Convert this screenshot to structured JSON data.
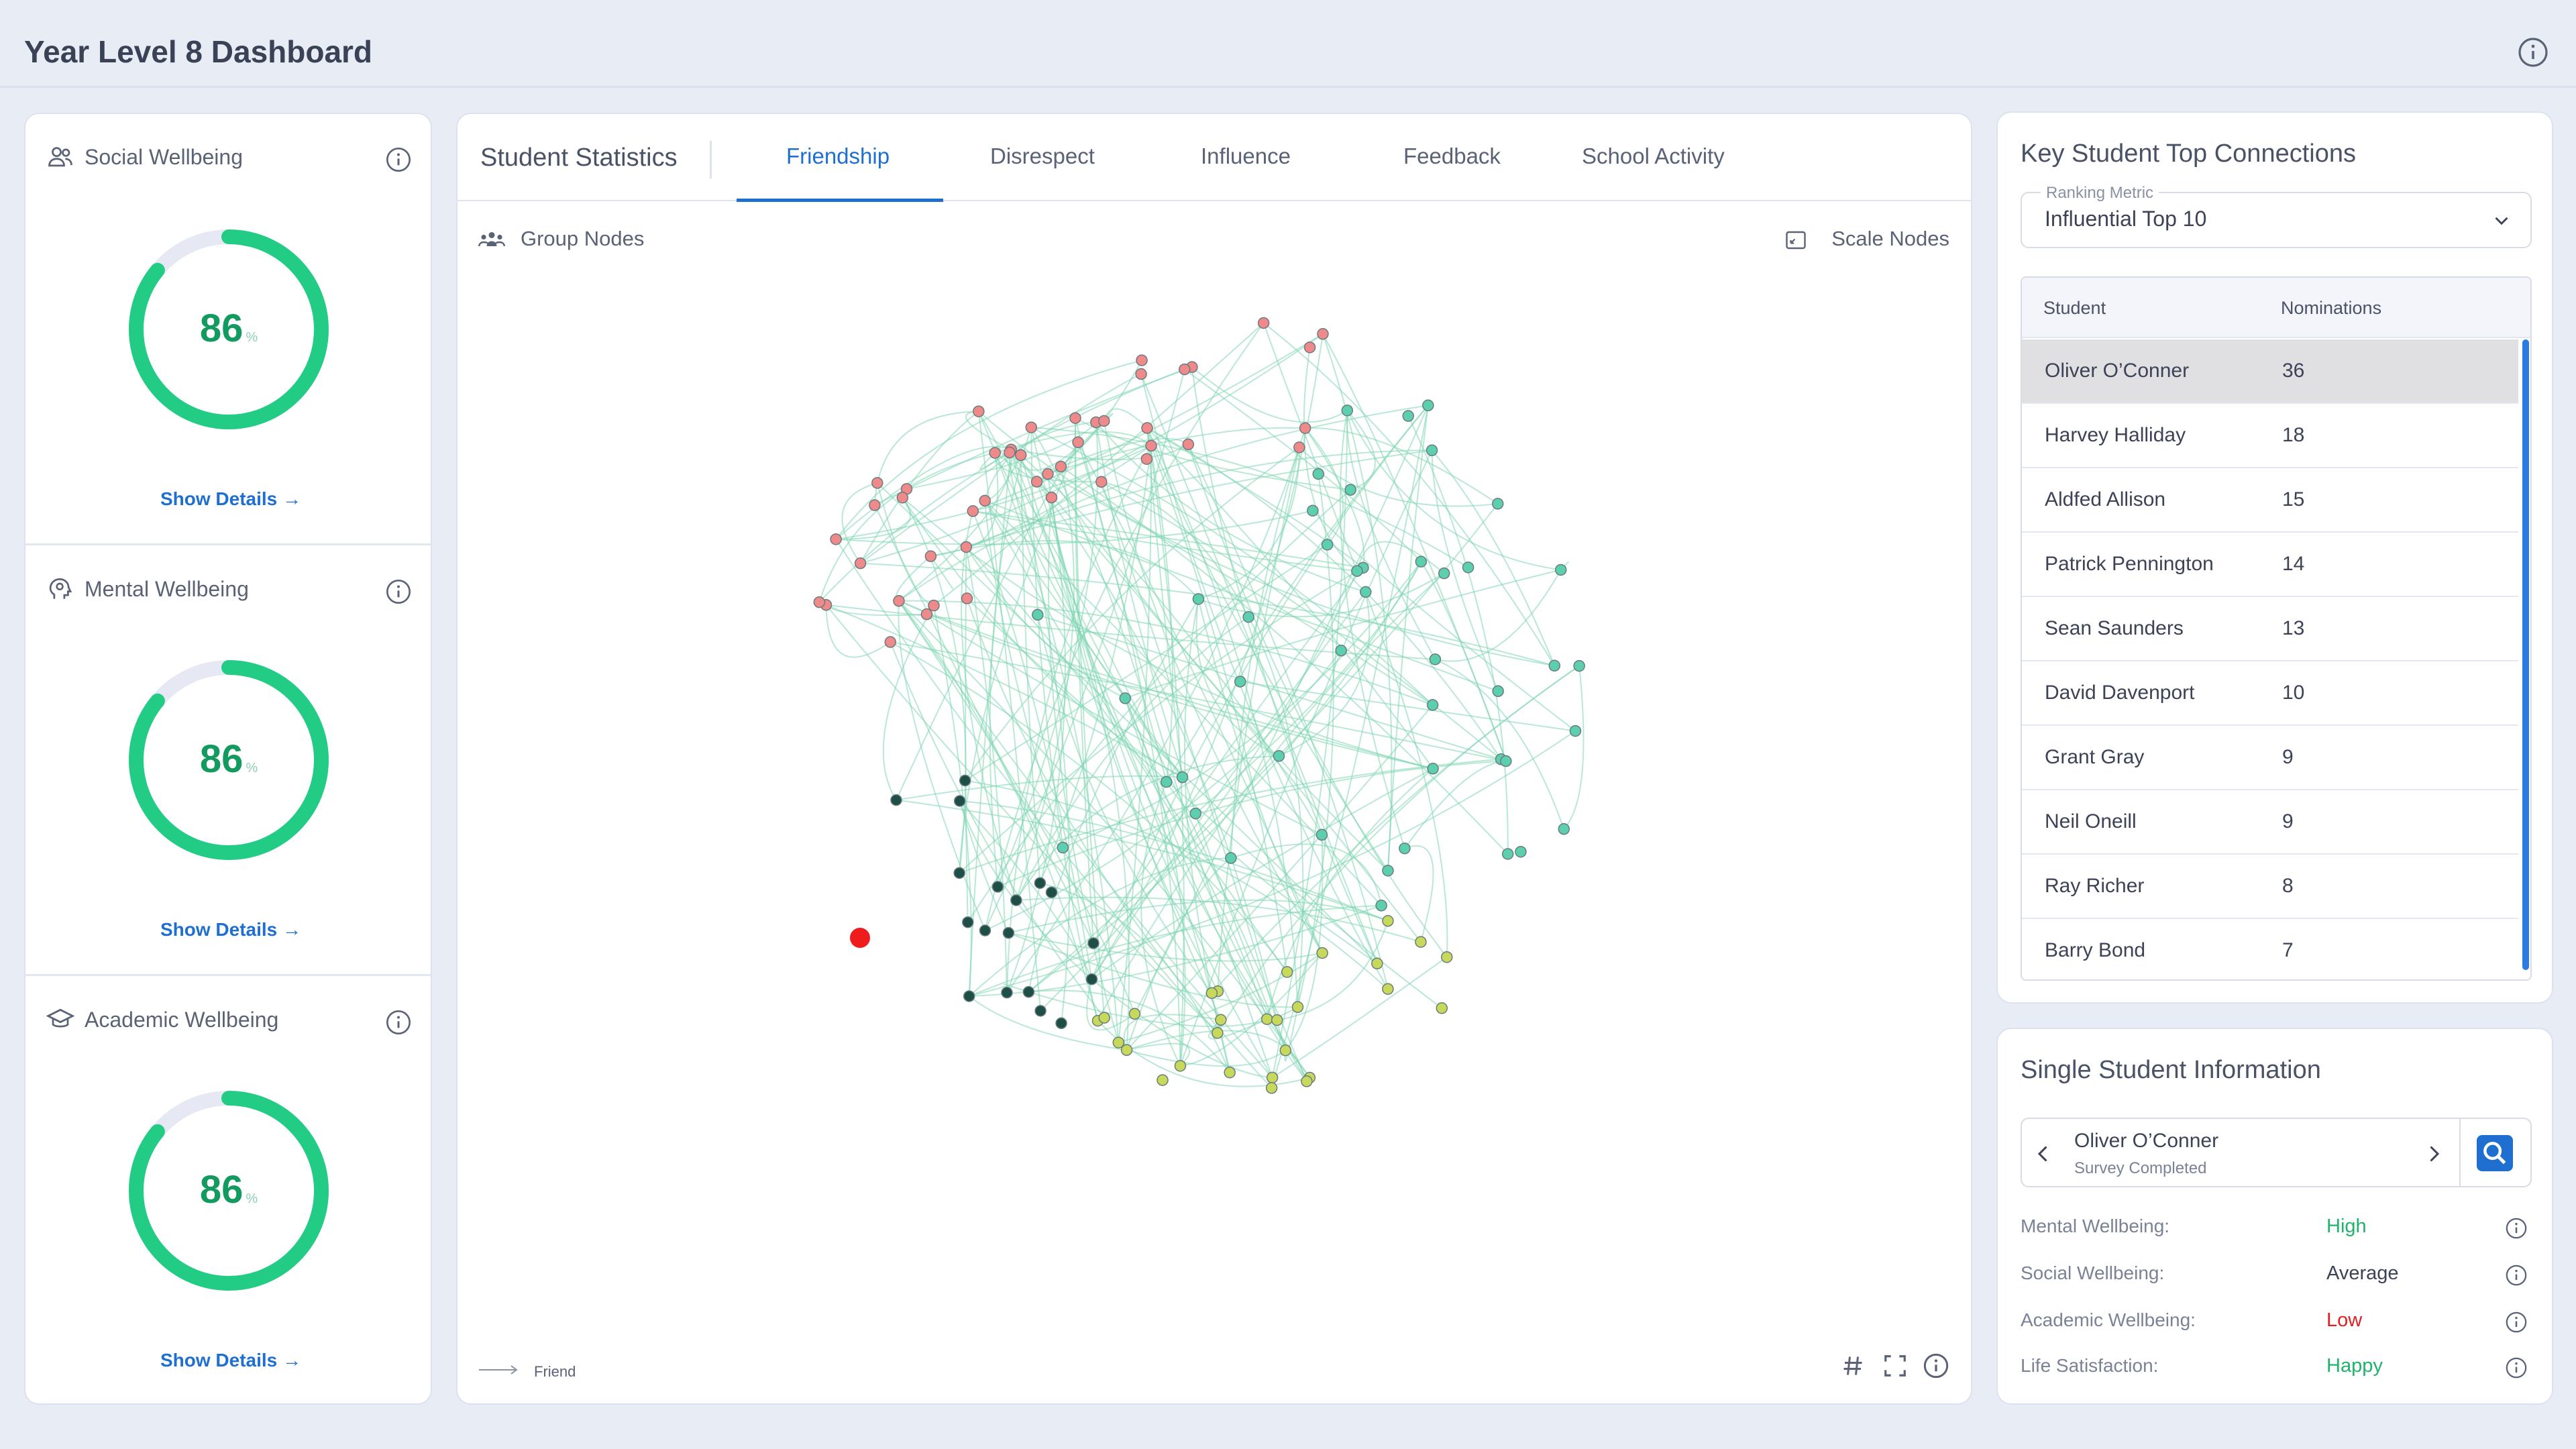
{
  "page": {
    "title": "Year Level 8 Dashboard"
  },
  "wellbeing": [
    {
      "title": "Social Wellbeing",
      "icon": "users-icon",
      "value": "86",
      "unit": "%",
      "fraction": 0.86,
      "link": "Show Details"
    },
    {
      "title": "Mental Wellbeing",
      "icon": "head-brain-icon",
      "value": "86",
      "unit": "%",
      "fraction": 0.86,
      "link": "Show Details"
    },
    {
      "title": "Academic Wellbeing",
      "icon": "graduation-cap-icon",
      "value": "86",
      "unit": "%",
      "fraction": 0.86,
      "link": "Show Details"
    }
  ],
  "stats": {
    "title": "Student Statistics",
    "tabs": [
      "Friendship",
      "Disrespect",
      "Influence",
      "Feedback",
      "School Activity"
    ],
    "active_tab": "Friendship",
    "group_nodes": "Group Nodes",
    "scale_nodes": "Scale Nodes",
    "legend": "Friend",
    "toolbar": [
      "hash-icon",
      "fullscreen-icon",
      "info-icon"
    ]
  },
  "colors": {
    "accent": "#1f6fd1",
    "gauge": "#22cc84",
    "gauge_track": "#e6e9f3",
    "edge": "#7fd6b2",
    "node_red": "#ef8a8a",
    "node_green": "#5ccfae",
    "node_yellow": "#c6d95a",
    "node_dark": "#1e4f47",
    "node_highlight": "#ee1c1c",
    "status_high": "#20b36b",
    "status_low": "#e02020"
  },
  "connections": {
    "title": "Key Student Top Connections",
    "ranking_label": "Ranking Metric",
    "ranking_value": "Influential Top 10",
    "columns": [
      "Student",
      "Nominations"
    ],
    "rows": [
      {
        "student": "Oliver O’Conner",
        "nominations": "36"
      },
      {
        "student": "Harvey Halliday",
        "nominations": "18"
      },
      {
        "student": "Aldfed Allison",
        "nominations": "15"
      },
      {
        "student": "Patrick Pennington",
        "nominations": "14"
      },
      {
        "student": "Sean Saunders",
        "nominations": "13"
      },
      {
        "student": "David Davenport",
        "nominations": "10"
      },
      {
        "student": "Grant Gray",
        "nominations": "9"
      },
      {
        "student": "Neil Oneill",
        "nominations": "9"
      },
      {
        "student": "Ray Richer",
        "nominations": "8"
      },
      {
        "student": "Barry Bond",
        "nominations": "7"
      }
    ]
  },
  "single": {
    "title": "Single Student Information",
    "student": "Oliver O’Conner",
    "status": "Survey Completed",
    "fields": [
      {
        "label": "Mental Wellbeing:",
        "value": "High",
        "level": "good"
      },
      {
        "label": "Social Wellbeing:",
        "value": "Average",
        "level": "avg"
      },
      {
        "label": "Academic Wellbeing:",
        "value": "Low",
        "level": "low"
      },
      {
        "label": "Life Satisfaction:",
        "value": "Happy",
        "level": "good"
      }
    ]
  }
}
